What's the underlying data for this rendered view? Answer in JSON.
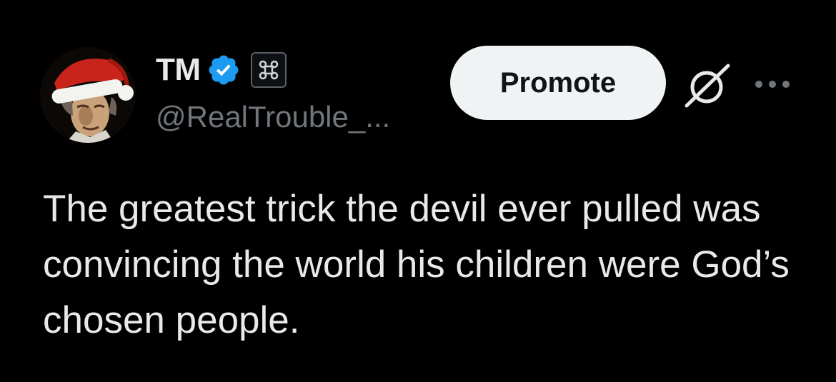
{
  "author": {
    "display_name": "TM",
    "handle": "@RealTrouble_...",
    "verified_badge_color": "#1d9bf0",
    "affiliation_badge_icon": "command-key-icon"
  },
  "actions": {
    "promote_label": "Promote",
    "grok_icon": "grok-icon",
    "more_icon": "more-horizontal-icon"
  },
  "tweet": {
    "text": "The greatest trick the devil ever pulled was convincing the world his children were God’s chosen people."
  },
  "colors": {
    "background": "#000000",
    "primary_text": "#e7e9ea",
    "secondary_text": "#71767b",
    "button_bg": "#eff3f4"
  }
}
